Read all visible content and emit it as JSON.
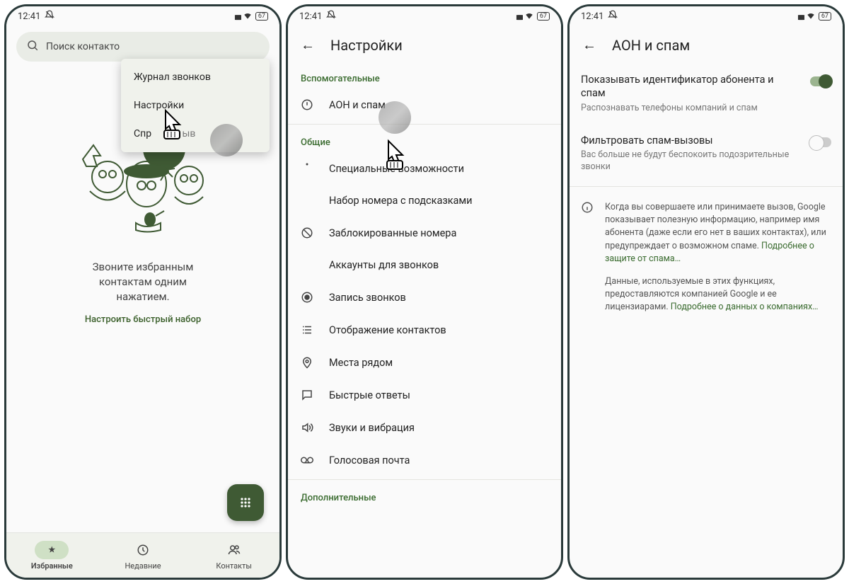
{
  "statusbar": {
    "time": "12:41",
    "battery": "67"
  },
  "screen1": {
    "search_placeholder": "Поиск контакто",
    "menu": {
      "item0": "Журнал звонков",
      "item1": "Настройки",
      "item2": "Спр"
    },
    "partial_text": "ыв",
    "empty_line1": "Звоните избранным",
    "empty_line2": "контактам одним",
    "empty_line3": "нажатием.",
    "link": "Настроить быстрый набор",
    "nav": {
      "fav": "Избранные",
      "recent": "Недавние",
      "contacts": "Контакты"
    }
  },
  "screen2": {
    "title": "Настройки",
    "section_aux": "Вспомогательные",
    "row_caller": "АОН и спам",
    "section_general": "Общие",
    "row_a11y": "Специальные возможности",
    "row_assist": "Набор номера с подсказками",
    "row_blocked": "Заблокированные номера",
    "row_accounts": "Аккаунты для звонков",
    "row_record": "Запись звонков",
    "row_display": "Отображение контактов",
    "row_nearby": "Места рядом",
    "row_quick": "Быстрые ответы",
    "row_sound": "Звуки и вибрация",
    "row_voicemail": "Голосовая почта",
    "section_extra": "Дополнительные"
  },
  "screen3": {
    "title": "АОН и спам",
    "pref1_title": "Показывать идентификатор абонента и спам",
    "pref1_sub": "Распознавать телефоны компаний и спам",
    "pref2_title": "Фильтровать спам-вызовы",
    "pref2_sub": "Вас больше не будут беспокоить подозрительные звонки",
    "info1": "Когда вы совершаете или принимаете вызов, Google показывает полезную информацию, например имя абонента (даже если его нет в ваших контактах), или предупреждает о возможном спаме. ",
    "info1_link": "Подробнее о защите от спама…",
    "info2": "Данные, используемые в этих функциях, предоставляются компанией Google и ее лицензиарами. ",
    "info2_link": "Подробнее о данных о компаниях…"
  }
}
